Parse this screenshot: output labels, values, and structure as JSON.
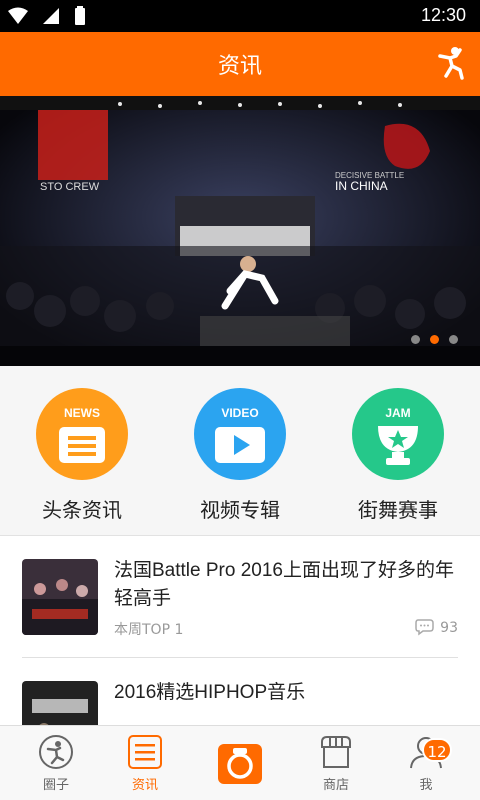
{
  "status": {
    "time": "12:30"
  },
  "appbar": {
    "title": "资讯"
  },
  "banner": {
    "left_text": "STO CREW",
    "right_text_1": "DECISIVE BATTLE",
    "right_text_2": "IN CHINA",
    "dots": 3,
    "active_dot": 1
  },
  "categories": [
    {
      "tag": "NEWS",
      "label": "头条资讯",
      "color": "#ff9d1b"
    },
    {
      "tag": "VIDEO",
      "label": "视频专辑",
      "color": "#2ba4f0"
    },
    {
      "tag": "JAM",
      "label": "街舞赛事",
      "color": "#25c88a"
    }
  ],
  "articles": [
    {
      "title": "法国Battle Pro 2016上面出现了好多的年轻高手",
      "meta": "本周TOP 1",
      "comments": "93"
    },
    {
      "title": "2016精选HIPHOP音乐"
    }
  ],
  "tabs": [
    {
      "label": "圈子"
    },
    {
      "label": "资讯"
    },
    {
      "label": ""
    },
    {
      "label": "商店"
    },
    {
      "label": "我",
      "badge": "12"
    }
  ],
  "colors": {
    "accent": "#ff6a00"
  }
}
